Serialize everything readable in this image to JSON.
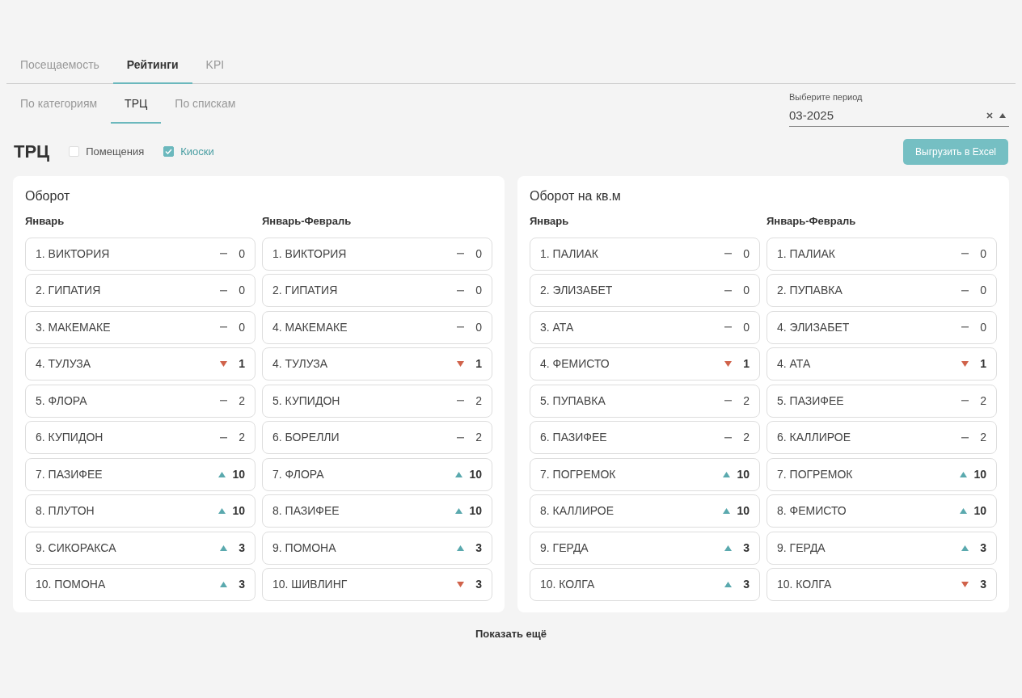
{
  "tabs": [
    {
      "label": "Посещаемость",
      "selected": false
    },
    {
      "label": "Рейтинги",
      "selected": true
    },
    {
      "label": "KPI",
      "selected": false
    }
  ],
  "subtabs": [
    {
      "label": "По категориям",
      "selected": false
    },
    {
      "label": "ТРЦ",
      "selected": true
    },
    {
      "label": "По спискам",
      "selected": false
    }
  ],
  "period": {
    "label": "Выберите период",
    "value": "03-2025"
  },
  "heading": "ТРЦ",
  "filters": [
    {
      "label": "Помещения",
      "checked": false
    },
    {
      "label": "Киоски",
      "checked": true
    }
  ],
  "export_button": "Выгрузить в Excel",
  "panels": [
    {
      "title": "Оборот",
      "columns": [
        {
          "title": "Январь",
          "rows": [
            {
              "name": "1. ВИКТОРИЯ",
              "kind": "same",
              "value": "0"
            },
            {
              "name": "2. ГИПАТИЯ",
              "kind": "same",
              "value": "0"
            },
            {
              "name": "3. МАКЕМАКЕ",
              "kind": "same",
              "value": "0"
            },
            {
              "name": "4. ТУЛУЗА",
              "kind": "down",
              "value": "1"
            },
            {
              "name": "5. ФЛОРА",
              "kind": "same",
              "value": "2"
            },
            {
              "name": "6. КУПИДОН",
              "kind": "same",
              "value": "2"
            },
            {
              "name": "7. ПАЗИФЕЕ",
              "kind": "up",
              "value": "10"
            },
            {
              "name": "8. ПЛУТОН",
              "kind": "up",
              "value": "10"
            },
            {
              "name": "9. СИКОРАКСА",
              "kind": "up",
              "value": "3"
            },
            {
              "name": "10. ПОМОНА",
              "kind": "up",
              "value": "3"
            }
          ]
        },
        {
          "title": "Январь-Февраль",
          "rows": [
            {
              "name": "1. ВИКТОРИЯ",
              "kind": "same",
              "value": "0"
            },
            {
              "name": "2. ГИПАТИЯ",
              "kind": "same",
              "value": "0"
            },
            {
              "name": "4. МАКЕМАКЕ",
              "kind": "same",
              "value": "0"
            },
            {
              "name": "4. ТУЛУЗА",
              "kind": "down",
              "value": "1"
            },
            {
              "name": "5. КУПИДОН",
              "kind": "same",
              "value": "2"
            },
            {
              "name": "6. БОРЕЛЛИ",
              "kind": "same",
              "value": "2"
            },
            {
              "name": "7. ФЛОРА",
              "kind": "up",
              "value": "10"
            },
            {
              "name": "8. ПАЗИФЕЕ",
              "kind": "up",
              "value": "10"
            },
            {
              "name": "9. ПОМОНА",
              "kind": "up",
              "value": "3"
            },
            {
              "name": "10. ШИВЛИНГ",
              "kind": "down",
              "value": "3"
            }
          ]
        }
      ]
    },
    {
      "title": "Оборот на кв.м",
      "columns": [
        {
          "title": "Январь",
          "rows": [
            {
              "name": "1. ПАЛИАК",
              "kind": "same",
              "value": "0"
            },
            {
              "name": "2. ЭЛИЗАБЕТ",
              "kind": "same",
              "value": "0"
            },
            {
              "name": "3. АТА",
              "kind": "same",
              "value": "0"
            },
            {
              "name": "4. ФЕМИСТО",
              "kind": "down",
              "value": "1"
            },
            {
              "name": "5. ПУПАВКА",
              "kind": "same",
              "value": "2"
            },
            {
              "name": "6. ПАЗИФЕЕ",
              "kind": "same",
              "value": "2"
            },
            {
              "name": "7. ПОГРЕМОК",
              "kind": "up",
              "value": "10"
            },
            {
              "name": "8. КАЛЛИРОЕ",
              "kind": "up",
              "value": "10"
            },
            {
              "name": "9. ГЕРДА",
              "kind": "up",
              "value": "3"
            },
            {
              "name": "10. КОЛГА",
              "kind": "up",
              "value": "3"
            }
          ]
        },
        {
          "title": "Январь-Февраль",
          "rows": [
            {
              "name": "1. ПАЛИАК",
              "kind": "same",
              "value": "0"
            },
            {
              "name": "2. ПУПАВКА",
              "kind": "same",
              "value": "0"
            },
            {
              "name": "4. ЭЛИЗАБЕТ",
              "kind": "same",
              "value": "0"
            },
            {
              "name": "4. АТА",
              "kind": "down",
              "value": "1"
            },
            {
              "name": "5. ПАЗИФЕЕ",
              "kind": "same",
              "value": "2"
            },
            {
              "name": "6. КАЛЛИРОЕ",
              "kind": "same",
              "value": "2"
            },
            {
              "name": "7. ПОГРЕМОК",
              "kind": "up",
              "value": "10"
            },
            {
              "name": "8. ФЕМИСТО",
              "kind": "up",
              "value": "10"
            },
            {
              "name": "9. ГЕРДА",
              "kind": "up",
              "value": "3"
            },
            {
              "name": "10. КОЛГА",
              "kind": "down",
              "value": "3"
            }
          ]
        }
      ]
    }
  ],
  "show_more": "Показать ещё"
}
